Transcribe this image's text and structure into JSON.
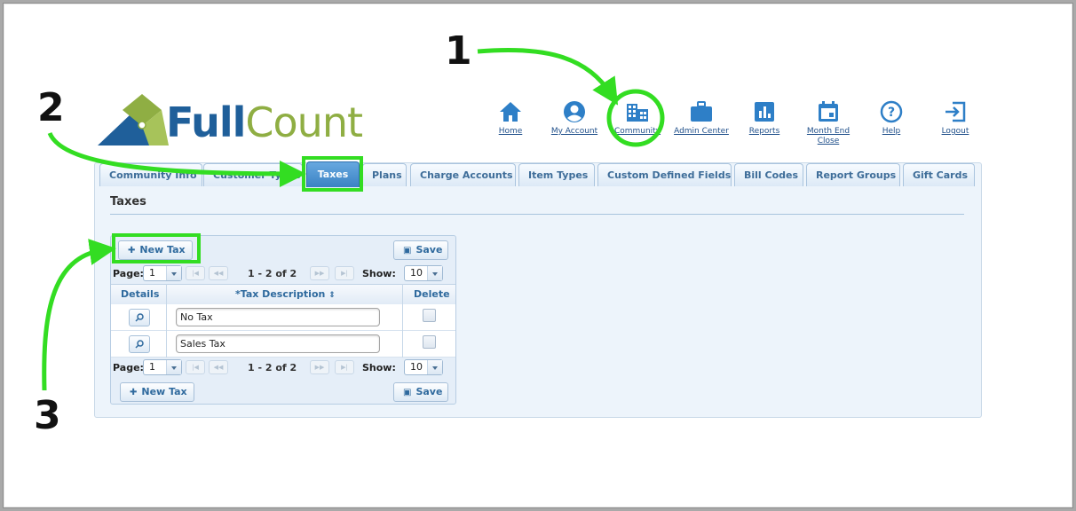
{
  "logo": {
    "part1": "Full",
    "part2": "Count"
  },
  "nav": [
    {
      "label": "Home",
      "icon": "home-icon"
    },
    {
      "label": "My Account",
      "icon": "account-circle-icon"
    },
    {
      "label": "Community",
      "icon": "building-icon"
    },
    {
      "label": "Admin Center",
      "icon": "briefcase-icon"
    },
    {
      "label": "Reports",
      "icon": "bar-chart-icon"
    },
    {
      "label_line1": "Month End",
      "label_line2": "Close",
      "icon": "calendar-icon"
    },
    {
      "label": "Help",
      "icon": "help-circle-icon"
    },
    {
      "label": "Logout",
      "icon": "logout-icon"
    }
  ],
  "tabs": [
    {
      "label": "Community Info"
    },
    {
      "label": "Customer Types"
    },
    {
      "label": "Taxes",
      "active": true
    },
    {
      "label": "Plans"
    },
    {
      "label": "Charge Accounts"
    },
    {
      "label": "Item Types"
    },
    {
      "label": "Custom Defined Fields"
    },
    {
      "label": "Bill Codes"
    },
    {
      "label": "Report Groups"
    },
    {
      "label": "Gift Cards"
    }
  ],
  "section_title": "Taxes",
  "toolbar": {
    "new_label": "New Tax",
    "save_label": "Save"
  },
  "pager": {
    "page_label": "Page:",
    "page_value": "1",
    "range": "1 - 2 of 2",
    "show_label": "Show:",
    "show_value": "10"
  },
  "columns": {
    "details": "Details",
    "description": "*Tax Description",
    "delete": "Delete"
  },
  "rows": [
    {
      "description": "No Tax"
    },
    {
      "description": "Sales Tax"
    }
  ],
  "annotations": {
    "n1": "1",
    "n2": "2",
    "n3": "3"
  },
  "colors": {
    "highlight_green": "#33dd22",
    "brand_blue": "#1f5f9a",
    "brand_green": "#8fae43",
    "active_tab": "#3b82c4"
  }
}
